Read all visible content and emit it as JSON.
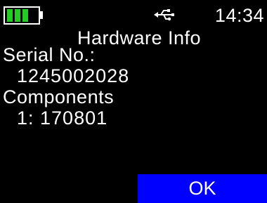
{
  "status_bar": {
    "battery_level_fraction": 1.0,
    "battery_color": "#22cc22",
    "usb_icon": "usb-icon",
    "time": "14:34"
  },
  "page": {
    "title": "Hardware Info"
  },
  "info": {
    "serial_label": "Serial No.:",
    "serial_value": "1245002028",
    "components_label": "Components",
    "components_value": "1: 170801"
  },
  "softkeys": {
    "ok_label": "OK",
    "ok_color": "#0000ff"
  }
}
